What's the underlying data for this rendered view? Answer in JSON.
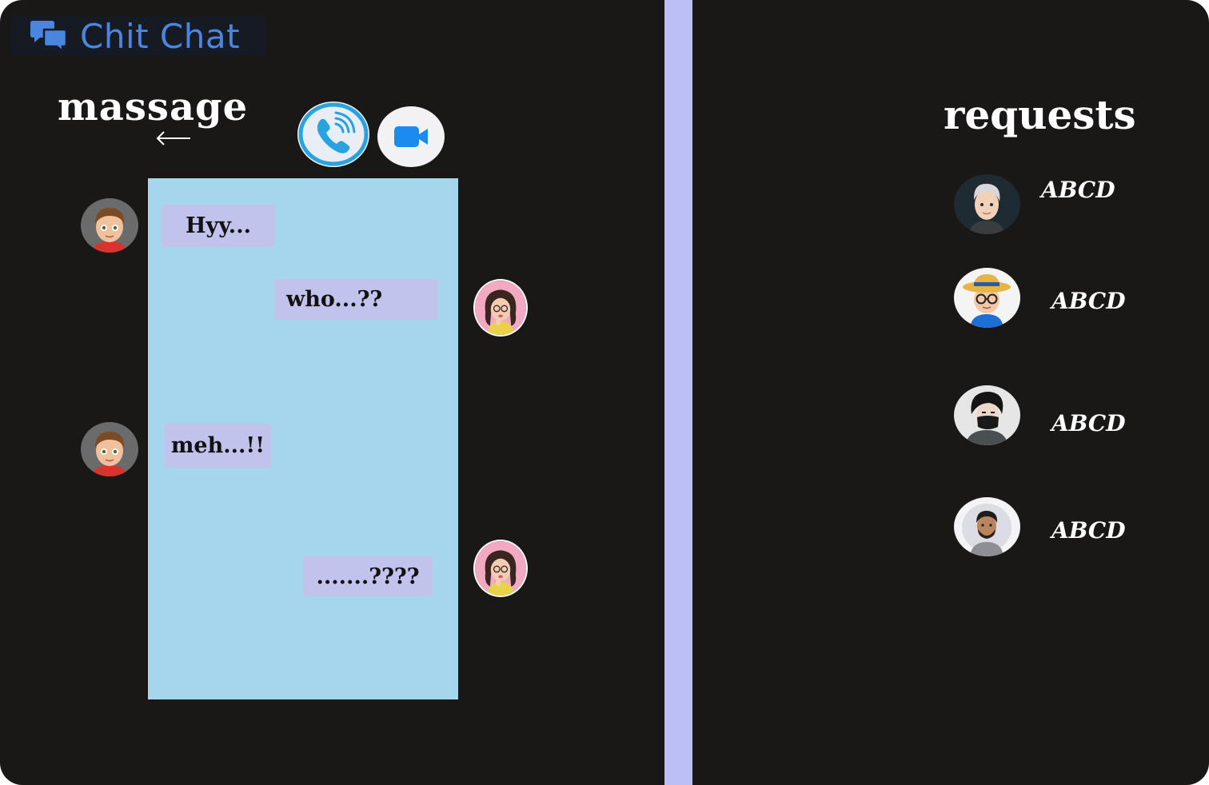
{
  "app": {
    "logo_text": "Chit Chat"
  },
  "chat": {
    "title": "massage",
    "messages": [
      {
        "text": "Hyy...",
        "sender": "boy"
      },
      {
        "text": "who...??",
        "sender": "girl"
      },
      {
        "text": "meh...!!",
        "sender": "boy"
      },
      {
        "text": ".......????",
        "sender": "girl"
      }
    ]
  },
  "requests": {
    "title": "requests",
    "items": [
      {
        "name": "ABCD",
        "avatar": "silver-hair-man"
      },
      {
        "name": "ABCD",
        "avatar": "hat-glasses-boy"
      },
      {
        "name": "ABCD",
        "avatar": "masked-guy"
      },
      {
        "name": "ABCD",
        "avatar": "bearded-man"
      }
    ]
  },
  "colors": {
    "background": "#1a1717",
    "chat_panel": "#a6d6ed",
    "bubble": "#c2c3ec",
    "divider": "#bcbff5",
    "logo_blue": "#4a86e0",
    "call_blue": "#29a3e0",
    "video_blue": "#1a8cf0"
  }
}
